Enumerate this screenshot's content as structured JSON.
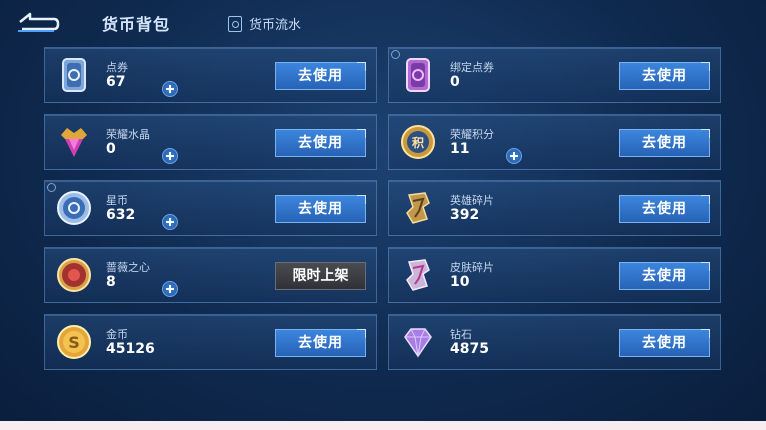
{
  "header": {
    "title": "货币背包",
    "flow_label": "货币流水"
  },
  "currencies": [
    {
      "name": "点券",
      "amount": "67",
      "button": "去使用"
    },
    {
      "name": "绑定点券",
      "amount": "0",
      "button": "去使用"
    },
    {
      "name": "荣耀水晶",
      "amount": "0",
      "button": "去使用"
    },
    {
      "name": "荣耀积分",
      "amount": "11",
      "button": "去使用"
    },
    {
      "name": "星币",
      "amount": "632",
      "button": "去使用"
    },
    {
      "name": "英雄碎片",
      "amount": "392",
      "button": "去使用"
    },
    {
      "name": "蔷薇之心",
      "amount": "8",
      "button": "限时上架"
    },
    {
      "name": "皮肤碎片",
      "amount": "10",
      "button": "去使用"
    },
    {
      "name": "金币",
      "amount": "45126",
      "button": "去使用"
    },
    {
      "name": "钻石",
      "amount": "4875",
      "button": "去使用"
    }
  ],
  "icons": {
    "back": "back-arrow-icon",
    "flow": "currency-flow-icon",
    "items": [
      "coupon-icon",
      "bound-coupon-icon",
      "crystal-icon",
      "honor-points-icon",
      "star-coin-icon",
      "hero-shard-icon",
      "rose-heart-icon",
      "skin-shard-icon",
      "gold-coin-icon",
      "diamond-icon"
    ]
  },
  "colors": {
    "button_blue": "#2f74c9",
    "button_disabled": "#3d3f44",
    "background": "#12305a"
  }
}
